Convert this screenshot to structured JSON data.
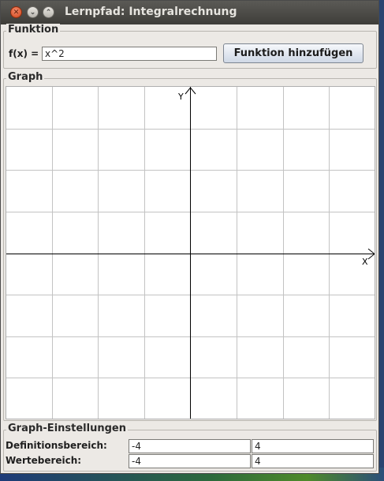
{
  "window": {
    "title": "Lernpfad: Integralrechnung"
  },
  "funktion": {
    "legend": "Funktion",
    "label": "f(x) =",
    "value": "x^2",
    "button_label": "Funktion hinzufügen"
  },
  "graph": {
    "legend": "Graph",
    "x_axis_label": "X",
    "y_axis_label": "Y"
  },
  "settings": {
    "legend": "Graph-Einstellungen",
    "domain_label": "Definitionsbereich:",
    "domain_min": "-4",
    "domain_max": "4",
    "range_label": "Wertebereich:",
    "range_min": "-4",
    "range_max": "4"
  }
}
